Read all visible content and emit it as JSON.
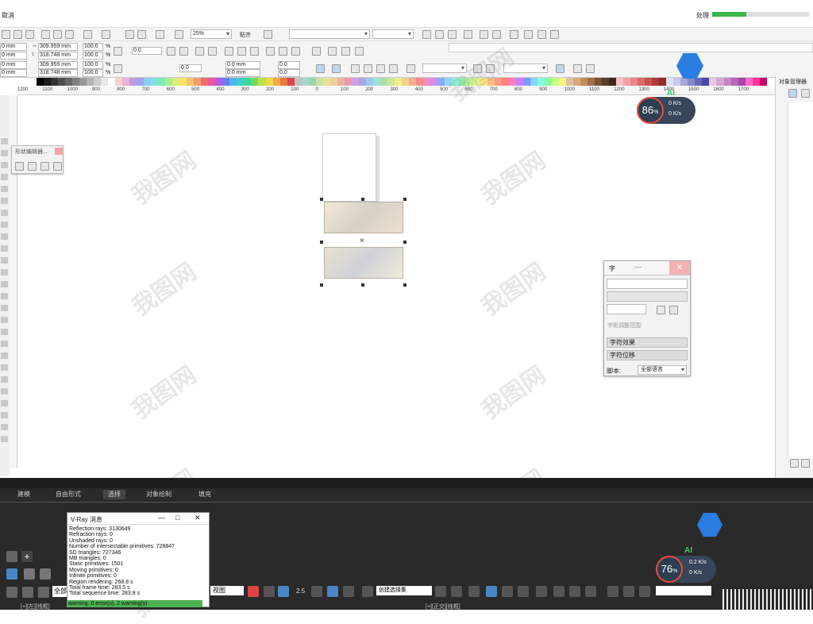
{
  "title_bar": {
    "cancel_label": "取消",
    "processing_label": "处理",
    "progress": 0.35
  },
  "toolbar": {
    "zoom_value": "25%",
    "snap_label": "贴齐"
  },
  "property_bar": {
    "x_value": "0 mm",
    "y_value": "0 mm",
    "width_value": "309.959 mm",
    "height_value": "318.748 mm",
    "width_value_2": "309.959 mm",
    "height_value_2": "318.748 mm",
    "scale_w": "100.0",
    "scale_h": "100.0",
    "scale_w_2": "100.0",
    "scale_h_2": "100.0",
    "percent_sign": "%",
    "rotation": "0.0",
    "rotation_2": "0.0",
    "pos_x_2": "0.0 mm",
    "pos_y_2": "0.0 mm",
    "offset_x": "0.0",
    "offset_y": "0.0"
  },
  "palette_colors": [
    "#000000",
    "#1a1a1a",
    "#333333",
    "#4d4d4d",
    "#666666",
    "#808080",
    "#999999",
    "#b3b3b3",
    "#cccccc",
    "#e6e6e6",
    "#ffffff",
    "#f5d0d0",
    "#e8b1d6",
    "#c59ae0",
    "#9aa8ea",
    "#8ccff0",
    "#7fe0e0",
    "#7fe8b8",
    "#a6ee8c",
    "#d9f07a",
    "#f7e36b",
    "#f7c26b",
    "#f29c6b",
    "#ee6b6b",
    "#e85a9c",
    "#b65ae8",
    "#6b7ef0",
    "#4cb5f0",
    "#3ccfcf",
    "#3fd69a",
    "#6ede5a",
    "#bfe048",
    "#f0d848",
    "#f0a848",
    "#e8783c",
    "#d94848",
    "#c2c2c2",
    "#a3d6cf",
    "#9ad6a8",
    "#c9e3a1",
    "#e8e29a",
    "#f0cf9a",
    "#eab39e",
    "#e69cb0",
    "#d19ee0",
    "#a7a7e6",
    "#9cc7ea",
    "#9ce0d9",
    "#a8e0a8",
    "#d0e69c",
    "#f2ee8c",
    "#f2d38c",
    "#f2b08c",
    "#f28c8c",
    "#f28cc2",
    "#d18cf2",
    "#8ca8f2",
    "#8cd6f2",
    "#8cf2d9",
    "#8cf2a8",
    "#b8f28c",
    "#e6f28c",
    "#ffe680",
    "#ffbf80",
    "#ff9980",
    "#ff8080",
    "#ff80bf",
    "#c880ff",
    "#8096ff",
    "#80d4ff",
    "#80ffe0",
    "#80ff9c",
    "#c8ff80",
    "#fff280",
    "#e0c0a0",
    "#d9a77a",
    "#c08a5a",
    "#a0704a",
    "#7a5236",
    "#5c3d28",
    "#3e2a1c",
    "#f2c2c2",
    "#f2a2a2",
    "#e88888",
    "#d86c6c",
    "#c75050",
    "#b03a3a",
    "#9a2a2a",
    "#e0e0f0",
    "#c8c8e8",
    "#a8a8d8",
    "#8888c8",
    "#6868b8",
    "#4848a8",
    "#e6c6e6",
    "#d6a6d6",
    "#c686c6",
    "#b666b6",
    "#a646a6",
    "#ff66cc",
    "#ff3399",
    "#cc0066"
  ],
  "ruler_labels": [
    "1200",
    "1100",
    "1000",
    "900",
    "800",
    "700",
    "600",
    "500",
    "400",
    "300",
    "200",
    "100",
    "0",
    "100",
    "200",
    "300",
    "400",
    "500",
    "600",
    "700",
    "800",
    "900",
    "1000",
    "1100",
    "1200",
    "1300",
    "1400",
    "1500",
    "1600",
    "1700"
  ],
  "shape_tool_popup": {
    "title": "形状编辑器..."
  },
  "right_panel": {
    "title": "对象管理器"
  },
  "char_panel": {
    "title": "字",
    "spacing_label": "字距调整范围:",
    "effects_label": "字符效果",
    "position_label": "字符位移",
    "script_label": "脚本:",
    "script_value": "全部语言"
  },
  "speed_badge_top": {
    "percent": "86",
    "unit": "%",
    "up": "0 K/s",
    "down": "0 K/s",
    "ai": "AI"
  },
  "speed_badge_bottom": {
    "percent": "76",
    "unit": "%",
    "up": "0.2 K/s",
    "down": "0 K/s",
    "ai": "AI"
  },
  "max_ribbon": {
    "tabs": [
      "建模",
      "自由形式",
      "选择",
      "对象绘制",
      "填充"
    ],
    "view_dropdown": "视图",
    "selection_set": "创建选择集",
    "all_label": "全部",
    "snap_val": "2.5",
    "status_left": "[+][左][线框]",
    "status_right": "[+][正交][线框]"
  },
  "vray": {
    "title": "V-Ray 消息",
    "lines": [
      "Reflection rays: 3130649",
      "Refraction rays: 0",
      "Unshaded rays: 0",
      "Number of intersectable primitives: 728847",
      "SD triangles: 727346",
      "MB triangles: 0",
      "Static primitives: 1501",
      "Moving primitives: 0",
      "Infinite primitives: 0",
      "Region rendering: 268.8 s",
      "Total frame time: 283.5 s",
      "Total sequence time: 283.8 s"
    ],
    "status": "warning: 0 error(s), 2 warning(s)"
  },
  "watermark_text": "我图网"
}
